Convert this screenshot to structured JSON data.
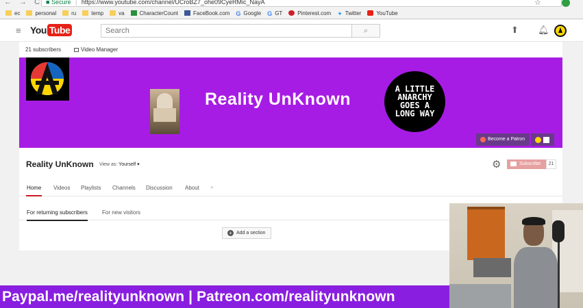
{
  "browser": {
    "secure_label": "Secure",
    "url": "https://www.youtube.com/channel/UCroBZ7_ohe09CyeRMic_NayA",
    "bookmarks": [
      {
        "label": "ec",
        "icon": "folder-icon"
      },
      {
        "label": "personal",
        "icon": "folder-icon"
      },
      {
        "label": "ru",
        "icon": "folder-icon"
      },
      {
        "label": "temp",
        "icon": "folder-icon"
      },
      {
        "label": "va",
        "icon": "folder-icon"
      },
      {
        "label": "CharacterCount",
        "icon": "charactercount-icon"
      },
      {
        "label": "FaceBook.com",
        "icon": "facebook-icon"
      },
      {
        "label": "Google",
        "icon": "google-icon"
      },
      {
        "label": "GT",
        "icon": "google-translate-icon"
      },
      {
        "label": "Pinterest.com",
        "icon": "pinterest-icon"
      },
      {
        "label": "Twitter",
        "icon": "twitter-icon"
      },
      {
        "label": "YouTube",
        "icon": "youtube-icon"
      }
    ]
  },
  "masthead": {
    "logo_you": "You",
    "logo_tube": "Tube",
    "search_placeholder": "Search"
  },
  "channel": {
    "subscribers_label": "21 subscribers",
    "video_manager_label": "Video Manager",
    "banner_title": "Reality UnKnown",
    "anarchy_lines": [
      "A LITTLE",
      "ANARCHY",
      "GOES A",
      "LONG WAY"
    ],
    "patron_label": "Become a Patron",
    "name": "Reality UnKnown",
    "view_as_label": "View as:",
    "view_as_value": "Yourself ▾",
    "subscribe_label": "Subscribe",
    "subscribe_count": "21",
    "tabs": [
      "Home",
      "Videos",
      "Playlists",
      "Channels",
      "Discussion",
      "About"
    ],
    "view_tabs": [
      "For returning subscribers",
      "For new visitors"
    ],
    "add_section_label": "Add a section"
  },
  "overlay": {
    "promo_text": "Paypal.me/realityunknown | Patreon.com/realityunknown"
  },
  "colors": {
    "banner_purple": "#a71ce4",
    "promo_purple": "#8a1ee0",
    "youtube_red": "#e62117"
  }
}
